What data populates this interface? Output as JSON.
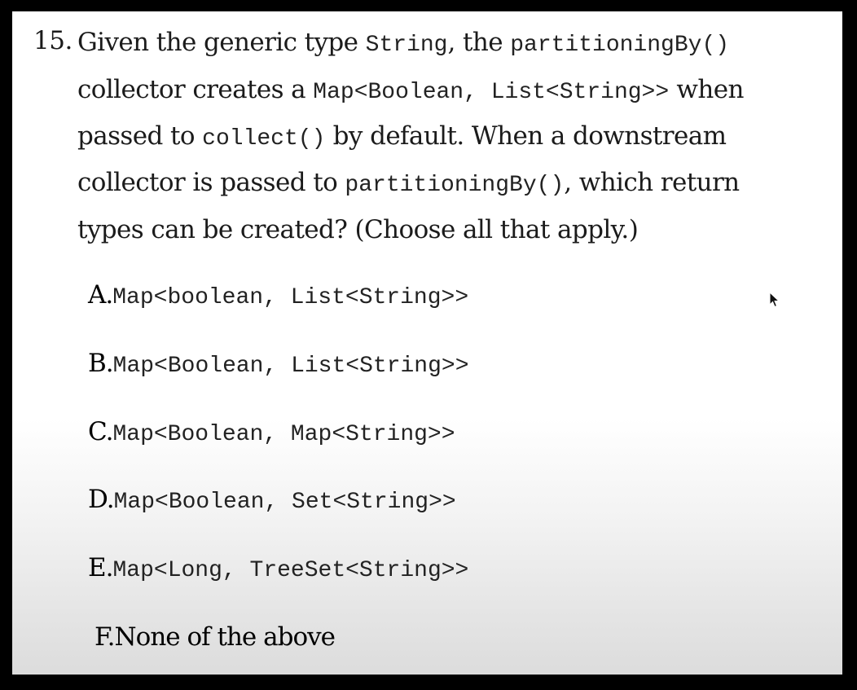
{
  "question": {
    "number": "15.",
    "line1": {
      "t1": "Given the generic type ",
      "c1": "String",
      "t2": ", the ",
      "c2": "partitioningBy()"
    },
    "line2": {
      "t1": "collector creates a ",
      "c1": "Map<Boolean, List<String>>",
      "t2": " when"
    },
    "line3": {
      "t1": "passed to ",
      "c1": "collect()",
      "t2": " by default. When a downstream"
    },
    "line4": {
      "t1": "collector is passed to ",
      "c1": "partitioningBy()",
      "t2": ", which return"
    },
    "line5": {
      "t1": "types can be created? (Choose all that apply.)"
    }
  },
  "options": [
    {
      "letter": "A.",
      "code": "Map<boolean, List<String>>"
    },
    {
      "letter": "B.",
      "code": "Map<Boolean, List<String>>"
    },
    {
      "letter": "C.",
      "code": "Map<Boolean, Map<String>>"
    },
    {
      "letter": "D.",
      "code": "Map<Boolean, Set<String>>"
    },
    {
      "letter": "E.",
      "code": "Map<Long, TreeSet<String>>"
    },
    {
      "letter": "F.",
      "text": "None of the above"
    }
  ],
  "colors": {
    "background": "#000000",
    "page": "#ffffff",
    "text": "#1b1b1b"
  },
  "icons": {
    "cursor": "mouse-pointer-icon"
  }
}
